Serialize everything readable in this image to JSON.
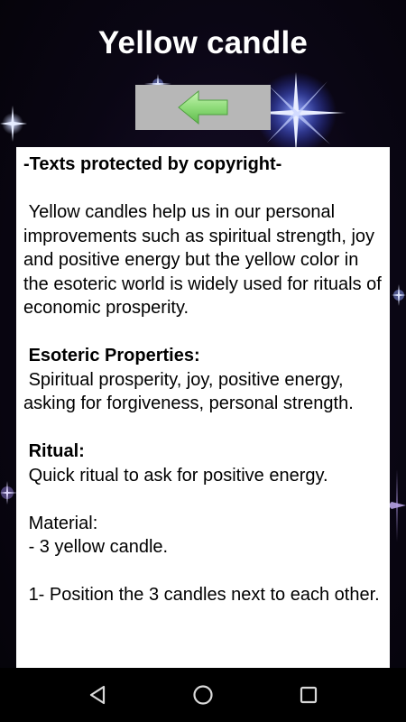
{
  "header": {
    "title": "Yellow candle"
  },
  "toolbar": {
    "back_icon": "left-arrow-icon",
    "arrow_color": "#8fdc7a"
  },
  "content": {
    "copyright_notice": "-Texts protected by copyright-",
    "intro": " Yellow candles help us in our personal improvements such as spiritual strength, joy and positive energy but the yellow color in the esoteric world is widely used for rituals of economic prosperity.",
    "properties_heading": " Esoteric Properties:",
    "properties_text": " Spiritual prosperity, joy, positive energy, asking for forgiveness, personal strength.",
    "ritual_heading": " Ritual:",
    "ritual_text": " Quick ritual to ask for positive energy.",
    "material_heading": " Material:",
    "material_item": " - 3 yellow candle.",
    "step_1": " 1- Position the 3 candles next to each other."
  },
  "navbar": {
    "back_icon": "triangle-back-icon",
    "home_icon": "circle-home-icon",
    "recents_icon": "square-recents-icon"
  }
}
